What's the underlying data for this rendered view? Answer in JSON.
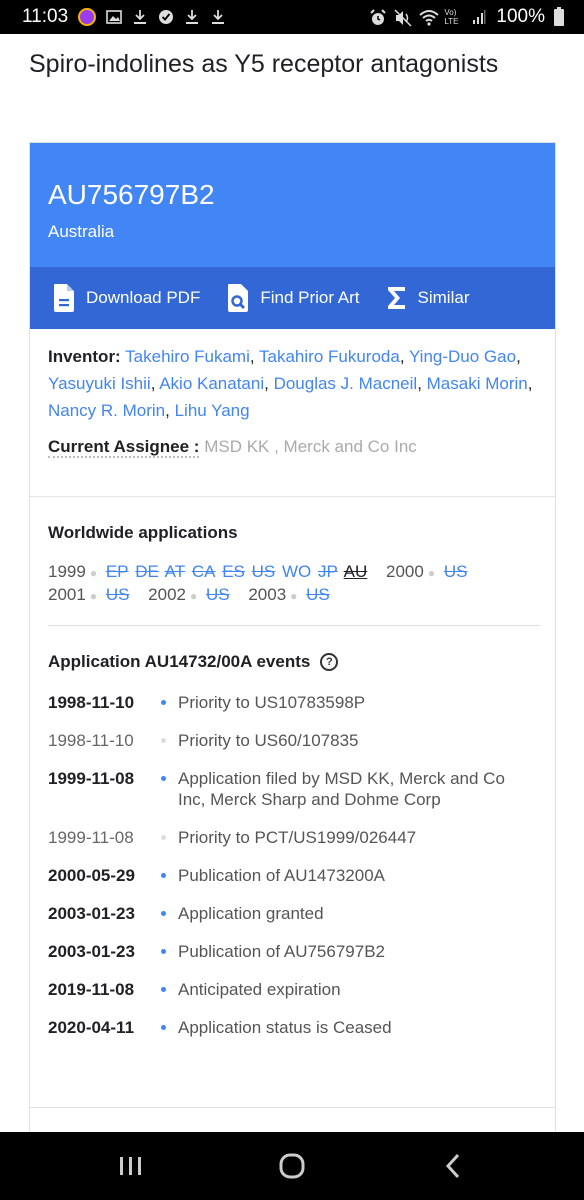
{
  "status_bar": {
    "time": "11:03",
    "battery": "100%",
    "left_icons": [
      "avatar-app-icon",
      "image-icon",
      "download-icon",
      "check-badge-icon",
      "download-icon",
      "download-icon"
    ],
    "right_icons": [
      "alarm-icon",
      "mute-icon",
      "wifi-icon",
      "volte-icon",
      "signal-icon",
      "battery-icon"
    ],
    "volte_label": "Vo) LTE"
  },
  "page": {
    "title": "Spiro-indolines as Y5 receptor antagonists"
  },
  "header": {
    "patent_number": "AU756797B2",
    "country": "Australia",
    "accent_color": "#4285f4",
    "action_bar_color": "#3367d6",
    "actions": [
      {
        "label": "Download PDF",
        "icon": "pdf-document-icon"
      },
      {
        "label": "Find Prior Art",
        "icon": "search-document-icon"
      },
      {
        "label": "Similar",
        "icon": "sigma-icon"
      }
    ]
  },
  "meta": {
    "inventor_label": "Inventor:",
    "inventors": [
      "Takehiro Fukami",
      "Takahiro Fukuroda",
      "Ying-Duo Gao",
      "Yasuyuki Ishii",
      "Akio Kanatani",
      "Douglas J. Macneil",
      "Masaki Morin",
      "Nancy R. Morin",
      "Lihu Yang"
    ],
    "assignee_label": "Current Assignee :",
    "assignee_value": "MSD KK , Merck and Co Inc"
  },
  "worldwide": {
    "heading": "Worldwide applications",
    "years": [
      {
        "year": "1999",
        "apps": [
          {
            "code": "EP",
            "struck": true
          },
          {
            "code": "DE",
            "struck": true
          },
          {
            "code": "AT",
            "struck": true
          },
          {
            "code": "CA",
            "struck": true
          },
          {
            "code": "ES",
            "struck": true
          },
          {
            "code": "US",
            "struck": true
          },
          {
            "code": "WO",
            "struck": false
          },
          {
            "code": "JP",
            "struck": true
          },
          {
            "code": "AU",
            "struck": true,
            "current": true
          }
        ]
      },
      {
        "year": "2000",
        "apps": [
          {
            "code": "US",
            "struck": true
          }
        ]
      },
      {
        "year": "2001",
        "apps": [
          {
            "code": "US",
            "struck": true
          }
        ]
      },
      {
        "year": "2002",
        "apps": [
          {
            "code": "US",
            "struck": true
          }
        ]
      },
      {
        "year": "2003",
        "apps": [
          {
            "code": "US",
            "struck": true
          }
        ]
      }
    ]
  },
  "events": {
    "heading": "Application AU14732/00A events",
    "help_icon": "?",
    "items": [
      {
        "date": "1998-11-10",
        "desc": "Priority to US10783598P",
        "primary": true
      },
      {
        "date": "1998-11-10",
        "desc": "Priority to US60/107835",
        "primary": false
      },
      {
        "date": "1999-11-08",
        "desc": "Application filed by MSD KK, Merck and Co Inc, Merck Sharp and Dohme Corp",
        "primary": true
      },
      {
        "date": "1999-11-08",
        "desc": "Priority to PCT/US1999/026447",
        "primary": false
      },
      {
        "date": "2000-05-29",
        "desc": "Publication of AU1473200A",
        "primary": true
      },
      {
        "date": "2003-01-23",
        "desc": "Application granted",
        "primary": true
      },
      {
        "date": "2003-01-23",
        "desc": "Publication of AU756797B2",
        "primary": true
      },
      {
        "date": "2019-11-08",
        "desc": "Anticipated expiration",
        "primary": true
      },
      {
        "date": "2020-04-11",
        "desc": "Application status is Ceased",
        "primary": true
      }
    ]
  },
  "nav_bar": {
    "buttons": [
      "recent-apps",
      "home",
      "back"
    ]
  }
}
